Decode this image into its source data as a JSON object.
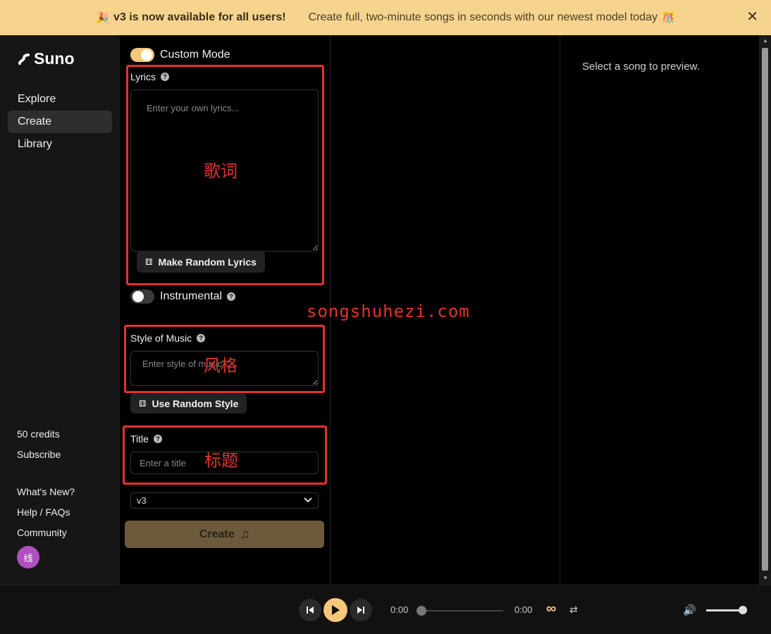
{
  "banner": {
    "emoji_left": "🎉",
    "headline": "v3 is now available for all users!",
    "message": "Create full, two-minute songs in seconds with our newest model today",
    "emoji_right": "🎊",
    "close": "✕"
  },
  "sidebar": {
    "logo": "Suno",
    "nav": [
      "Explore",
      "Create",
      "Library"
    ],
    "credits": "50 credits",
    "subscribe": "Subscribe",
    "whats_new": "What's New?",
    "help": "Help / FAQs",
    "community": "Community",
    "avatar_text": "线"
  },
  "create": {
    "custom_mode": "Custom Mode",
    "lyrics_label": "Lyrics",
    "lyrics_placeholder": "Enter your own lyrics...",
    "random_lyrics": "Make Random Lyrics",
    "instrumental": "Instrumental",
    "style_label": "Style of Music",
    "style_placeholder": "Enter style of music",
    "random_style": "Use Random Style",
    "title_label": "Title",
    "title_placeholder": "Enter a title",
    "model": "v3",
    "create_button": "Create"
  },
  "annotations": {
    "lyrics": "歌词",
    "style": "风格",
    "title": "标题",
    "watermark": "songshuhezi.com"
  },
  "preview": {
    "empty_text": "Select a song to preview."
  },
  "player": {
    "time_current": "0:00",
    "time_total": "0:00"
  },
  "colors": {
    "accent": "#f4c77a",
    "banner": "#f7d48e",
    "annotation_red": "#e0342c"
  }
}
